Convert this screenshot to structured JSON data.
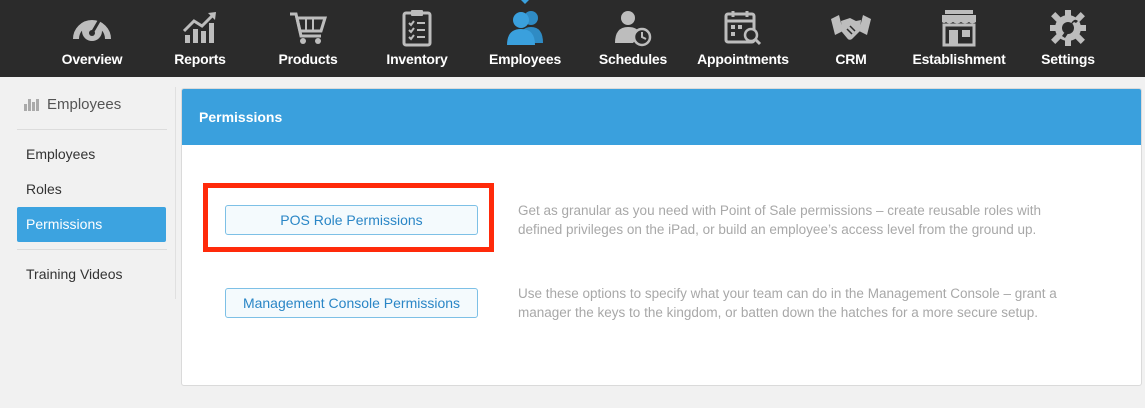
{
  "nav": {
    "items": [
      {
        "label": "Overview",
        "icon": "speedometer-icon"
      },
      {
        "label": "Reports",
        "icon": "chart-growth-icon"
      },
      {
        "label": "Products",
        "icon": "shopping-cart-icon"
      },
      {
        "label": "Inventory",
        "icon": "clipboard-checklist-icon"
      },
      {
        "label": "Employees",
        "icon": "people-icon",
        "active": true
      },
      {
        "label": "Schedules",
        "icon": "person-clock-icon"
      },
      {
        "label": "Appointments",
        "icon": "calendar-search-icon"
      },
      {
        "label": "CRM",
        "icon": "handshake-icon"
      },
      {
        "label": "Establishment",
        "icon": "storefront-icon"
      },
      {
        "label": "Settings",
        "icon": "gear-wrench-icon"
      }
    ],
    "active_color": "#3aa0dd"
  },
  "sidebar": {
    "title": "Employees",
    "items": [
      {
        "label": "Employees"
      },
      {
        "label": "Roles"
      },
      {
        "label": "Permissions",
        "active": true
      },
      {
        "label": "Training Videos"
      }
    ]
  },
  "panel": {
    "title": "Permissions",
    "rows": [
      {
        "button": "POS Role Permissions",
        "line1": "Get as granular as you need with Point of Sale permissions – create reusable roles with",
        "line2": "defined privileges on the iPad, or build an employee’s access level from the ground up."
      },
      {
        "button": "Management Console Permissions",
        "line1": "Use these options to specify what your team can do in the Management Console – grant a",
        "line2": "manager the keys to the kingdom, or batten down the hatches for a more secure setup."
      }
    ]
  },
  "colors": {
    "nav_bg": "#2b2b2b",
    "accent": "#3aa0dd",
    "highlight": "#ff2a0a"
  }
}
